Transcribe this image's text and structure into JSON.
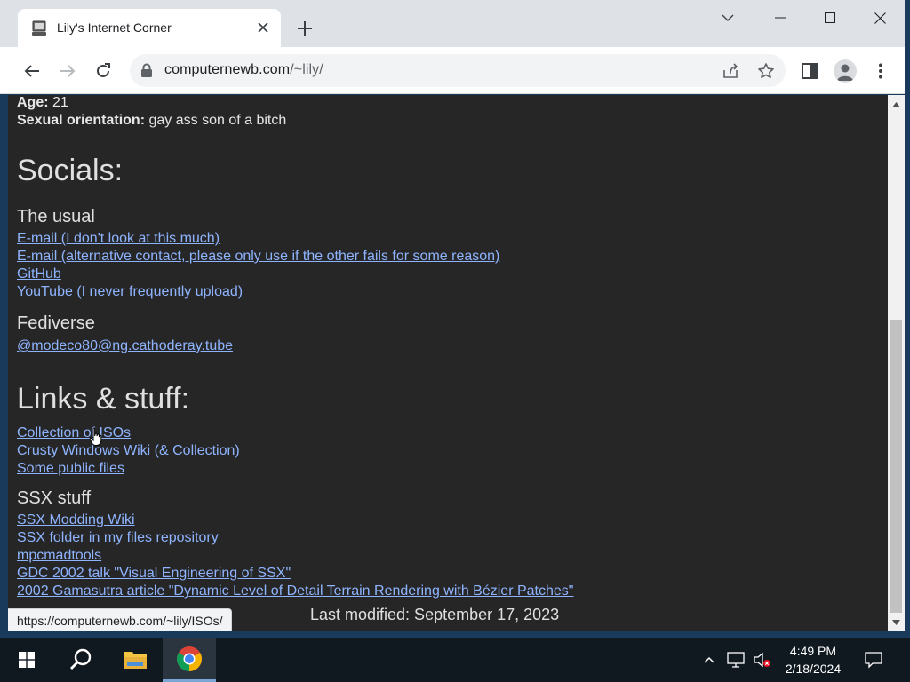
{
  "browser": {
    "tab_title": "Lily's Internet Corner",
    "url_domain": "computernewb.com",
    "url_path": "/~lily/",
    "status_url": "https://computernewb.com/~lily/ISOs/"
  },
  "page": {
    "age_label": "Age:",
    "age_value": "21",
    "orientation_label": "Sexual orientation:",
    "orientation_value": "gay ass son of a bitch",
    "socials_heading": "Socials:",
    "usual_heading": "The usual",
    "usual_links": [
      "E-mail (I don't look at this much)",
      "E-mail (alternative contact, please only use if the other fails for some reason)",
      "GitHub",
      "YouTube (I never frequently upload)"
    ],
    "fediverse_heading": "Fediverse",
    "fediverse_links": [
      "@modeco80@ng.cathoderay.tube"
    ],
    "links_heading": "Links & stuff:",
    "misc_links": [
      "Collection of ISOs",
      "Crusty Windows Wiki (& Collection)",
      "Some public files"
    ],
    "ssx_heading": "SSX stuff",
    "ssx_links": [
      "SSX Modding Wiki",
      "SSX folder in my files repository",
      "mpcmadtools",
      "GDC 2002 talk \"Visual Engineering of SSX\"",
      "2002 Gamasutra article \"Dynamic Level of Detail Terrain Rendering with Bézier Patches\""
    ],
    "last_modified": "Last modified: September 17, 2023"
  },
  "taskbar": {
    "time": "4:49 PM",
    "date": "2/18/2024"
  },
  "icons": {
    "tab_favicon": "computer-icon",
    "back": "back-arrow-icon",
    "forward": "forward-arrow-icon",
    "reload": "reload-icon",
    "lock": "lock-icon",
    "share": "share-icon",
    "bookmark": "star-icon",
    "side_panel": "side-panel-icon",
    "profile": "profile-icon",
    "menu": "kebab-menu-icon"
  },
  "colors": {
    "page_background": "#262626",
    "link": "#8fb4ff",
    "text": "#e6e6e6"
  }
}
